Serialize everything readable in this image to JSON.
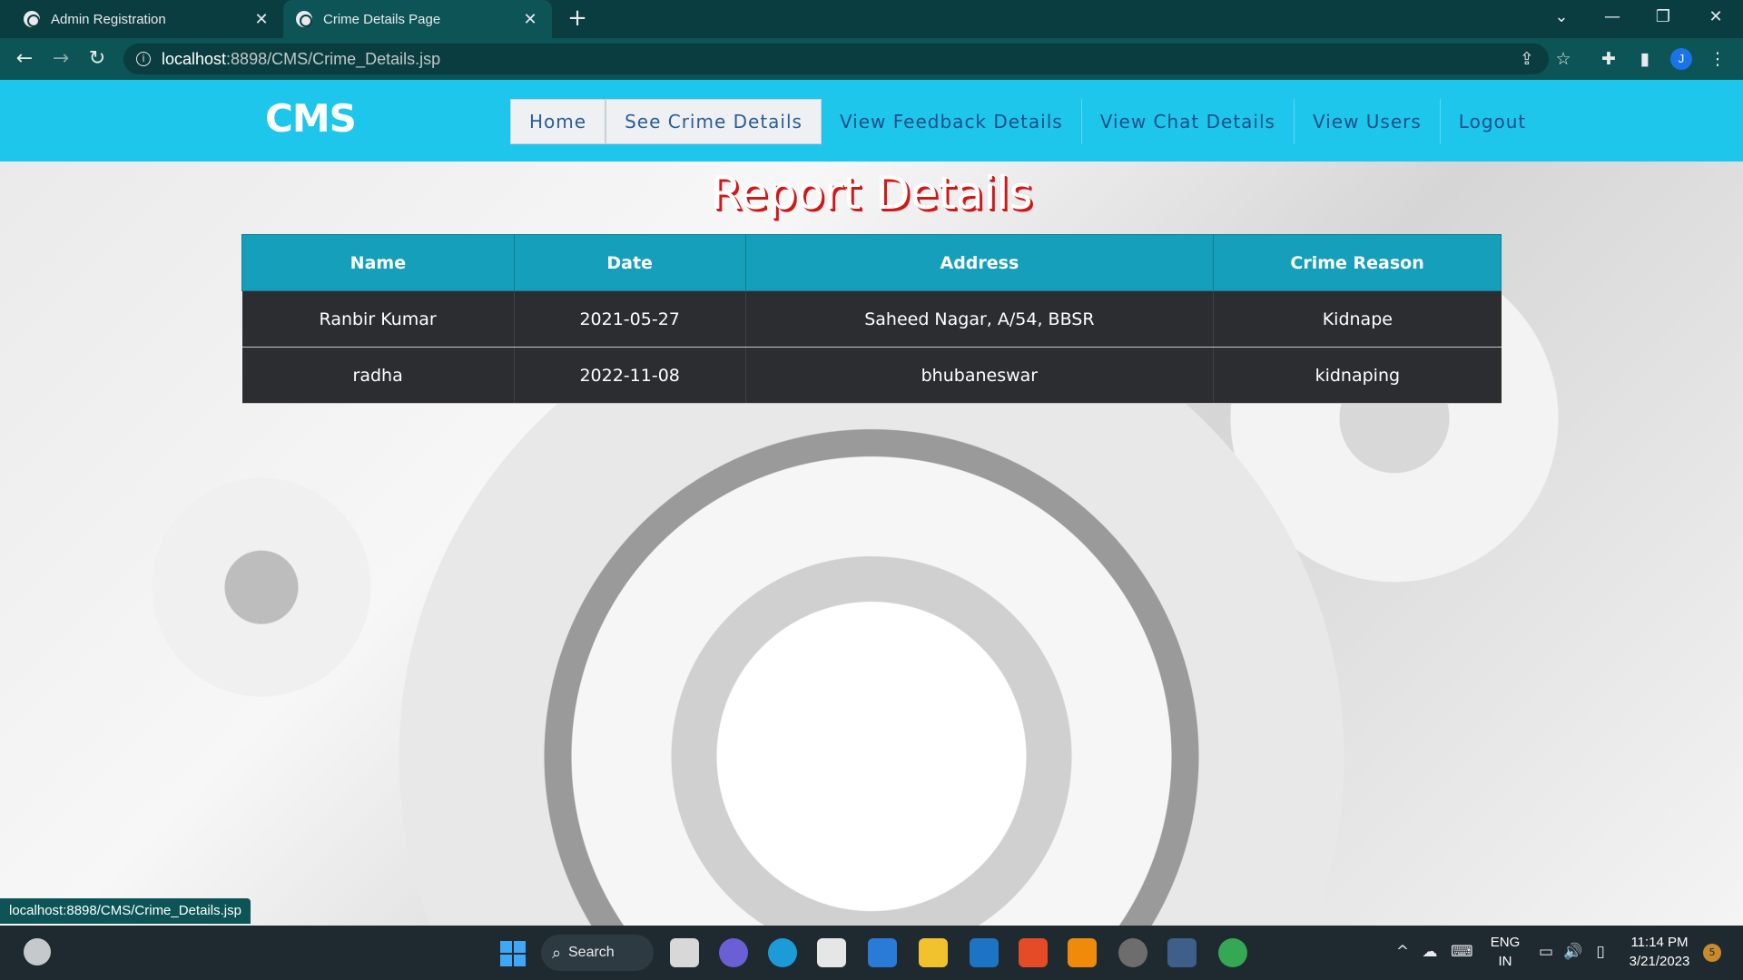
{
  "browser": {
    "tabs": [
      {
        "title": "Admin Registration",
        "active": false
      },
      {
        "title": "Crime Details Page",
        "active": true
      }
    ],
    "url_host": "localhost",
    "url_path": ":8898/CMS/Crime_Details.jsp",
    "status_url": "localhost:8898/CMS/Crime_Details.jsp",
    "profile_initial": "J",
    "icons": [
      "back-icon",
      "forward-icon",
      "reload-icon",
      "info-icon",
      "share-icon",
      "star-icon",
      "extensions-icon",
      "sidepanel-icon",
      "menu-icon"
    ]
  },
  "navbar": {
    "brand": "CMS",
    "items": [
      {
        "label": "Home"
      },
      {
        "label": "See Crime Details"
      },
      {
        "label": "View Feedback Details"
      },
      {
        "label": "View Chat Details"
      },
      {
        "label": "View Users"
      },
      {
        "label": "Logout"
      }
    ]
  },
  "main": {
    "title": "Report Details",
    "table": {
      "headers": [
        "Name",
        "Date",
        "Address",
        "Crime Reason"
      ],
      "rows": [
        [
          "Ranbir Kumar",
          "2021-05-27",
          "Saheed Nagar, A/54, BBSR",
          "Kidnape"
        ],
        [
          "radha",
          "2022-11-08",
          "bhubaneswar",
          "kidnaping"
        ]
      ]
    }
  },
  "taskbar": {
    "search_label": "Search",
    "language": "ENG",
    "region": "IN",
    "time": "11:14 PM",
    "date": "3/21/2023",
    "notifications": "5"
  },
  "colors": {
    "navbar": "#1ec6ec",
    "table_header": "#169fba",
    "table_body": "#2b2d31",
    "title_shadow": "#d01818"
  }
}
